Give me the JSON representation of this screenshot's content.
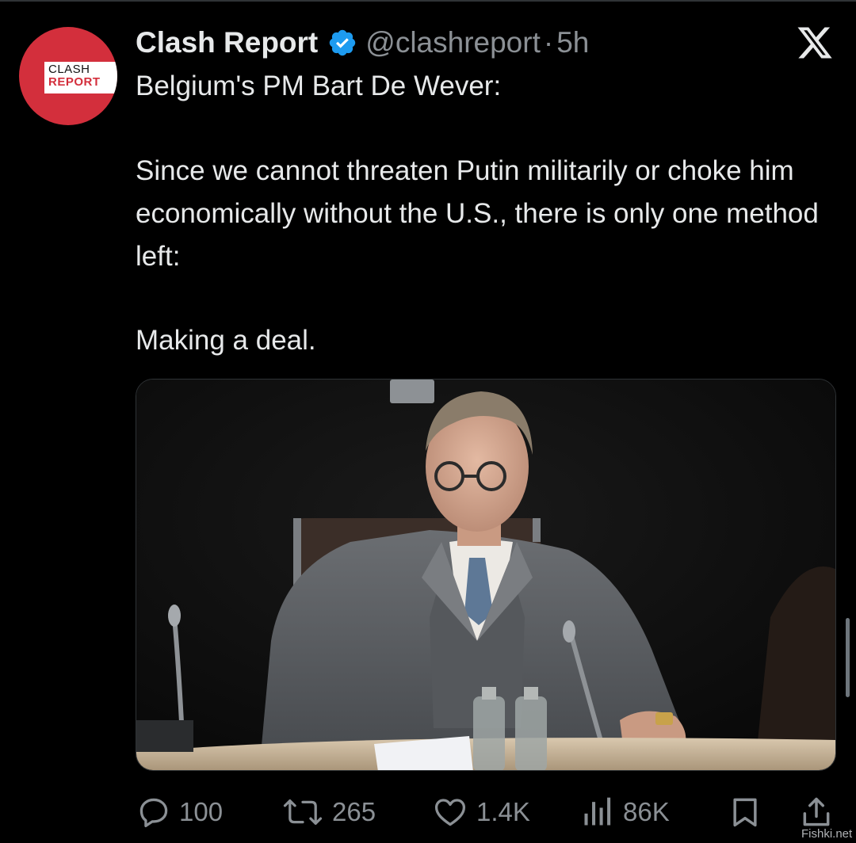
{
  "post": {
    "author_name": "Clash Report",
    "handle": "@clashreport",
    "separator": "·",
    "time": "5h",
    "avatar_line1": "CLASH",
    "avatar_line2": "REPORT",
    "text_intro": "Belgium's PM Bart De Wever:",
    "text_quote": "Since we cannot threaten Putin militarily or choke him economically without the U.S., there is only one method left:",
    "text_final": "Making a deal."
  },
  "actions": {
    "replies": "100",
    "reposts": "265",
    "likes": "1.4K",
    "views": "86K"
  },
  "watermark": "Fishki.net",
  "icons": [
    "verified-badge-icon",
    "x-logo-icon",
    "reply-icon",
    "repost-icon",
    "like-icon",
    "views-icon",
    "bookmark-icon",
    "share-icon"
  ],
  "colors": {
    "background": "#000000",
    "text": "#e7e9ea",
    "muted": "#8b9095",
    "verified": "#1d9bf0",
    "brand_red": "#d32f3c"
  }
}
